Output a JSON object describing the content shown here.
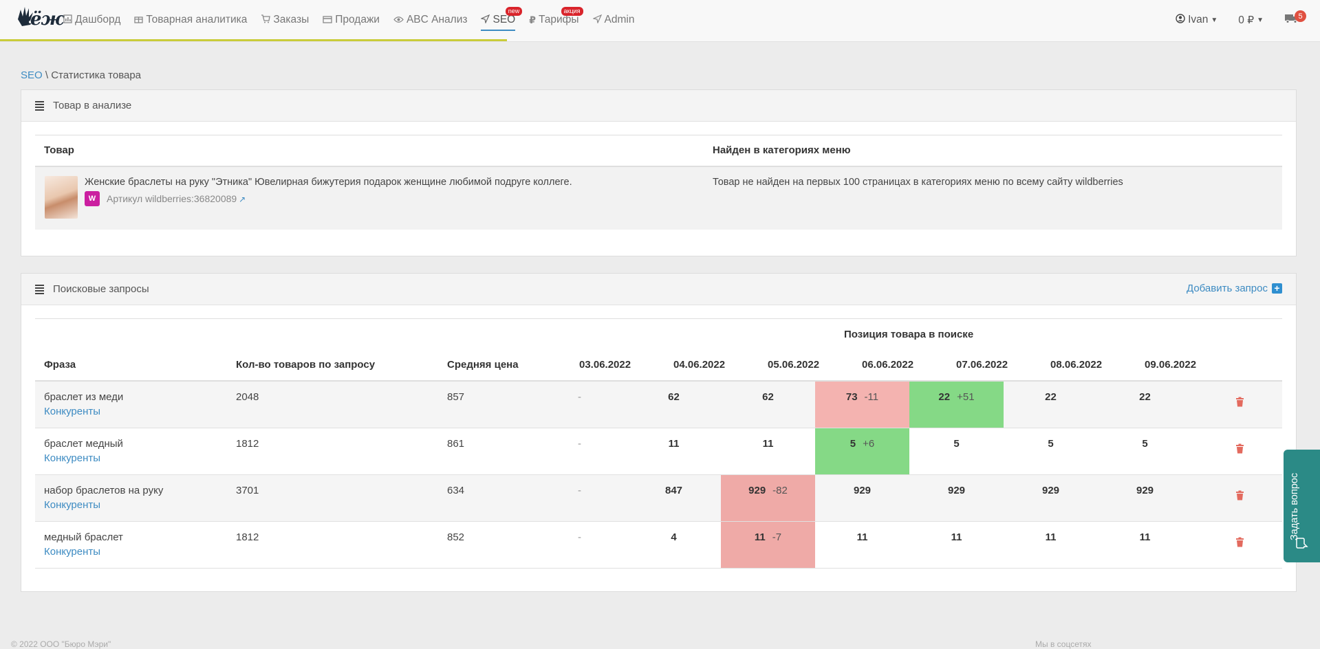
{
  "nav": {
    "logo": "ёж",
    "items": [
      {
        "label": "Дашборд",
        "icon": "bar-chart-icon"
      },
      {
        "label": "Товарная аналитика",
        "icon": "gift-icon"
      },
      {
        "label": "Заказы",
        "icon": "cart-icon"
      },
      {
        "label": "Продажи",
        "icon": "card-icon"
      },
      {
        "label": "ABC Анализ",
        "icon": "eye-icon"
      },
      {
        "label": "SEO",
        "icon": "send-icon",
        "badge": "new",
        "active": true
      },
      {
        "label": "Тарифы",
        "icon": "ruble-icon",
        "badge": "акция"
      },
      {
        "label": "Admin",
        "icon": "send-icon"
      }
    ],
    "user": "Ivan",
    "balance": "0 ₽",
    "cart_count": "5"
  },
  "breadcrumb": {
    "root": "SEO",
    "sep": " \\ ",
    "current": "Статистика товара"
  },
  "product_panel": {
    "title": "Товар в анализе",
    "col_product": "Товар",
    "col_found": "Найден в категориях меню",
    "product_name": "Женские браслеты на руку \"Этника\" Ювелирная бижутерия подарок женщине любимой подруге коллеге.",
    "wb_badge": "W",
    "article": "Артикул wildberries:36820089",
    "not_found": "Товар не найден на первых 100 страницах в категориях меню по всему сайту wildberries"
  },
  "queries_panel": {
    "title": "Поисковые запросы",
    "add_label": "Добавить запрос",
    "group_header": "Позиция товара в поиске",
    "headers": {
      "phrase": "Фраза",
      "count": "Кол-во товаров по запросу",
      "price": "Средняя цена"
    },
    "dates": [
      "03.06.2022",
      "04.06.2022",
      "05.06.2022",
      "06.06.2022",
      "07.06.2022",
      "08.06.2022",
      "09.06.2022"
    ],
    "competitors_label": "Конкуренты",
    "rows": [
      {
        "phrase": "браслет из меди",
        "count": "2048",
        "price": "857",
        "positions": [
          {
            "v": "-"
          },
          {
            "v": "62"
          },
          {
            "v": "62"
          },
          {
            "v": "73",
            "d": "-11",
            "hl": "red"
          },
          {
            "v": "22",
            "d": "+51",
            "hl": "green"
          },
          {
            "v": "22"
          },
          {
            "v": "22"
          }
        ]
      },
      {
        "phrase": "браслет медный",
        "count": "1812",
        "price": "861",
        "positions": [
          {
            "v": "-"
          },
          {
            "v": "11"
          },
          {
            "v": "11"
          },
          {
            "v": "5",
            "d": "+6",
            "hl": "green"
          },
          {
            "v": "5"
          },
          {
            "v": "5"
          },
          {
            "v": "5"
          }
        ]
      },
      {
        "phrase": "набор браслетов на руку",
        "count": "3701",
        "price": "634",
        "positions": [
          {
            "v": "-"
          },
          {
            "v": "847"
          },
          {
            "v": "929",
            "d": "-82",
            "hl": "red2"
          },
          {
            "v": "929"
          },
          {
            "v": "929"
          },
          {
            "v": "929"
          },
          {
            "v": "929"
          }
        ]
      },
      {
        "phrase": "медный браслет",
        "count": "1812",
        "price": "852",
        "positions": [
          {
            "v": "-"
          },
          {
            "v": "4"
          },
          {
            "v": "11",
            "d": "-7",
            "hl": "red2"
          },
          {
            "v": "11"
          },
          {
            "v": "11"
          },
          {
            "v": "11"
          },
          {
            "v": "11"
          }
        ]
      }
    ]
  },
  "help_tab": "Задать вопрос",
  "footer": {
    "left": "© 2022 ООО \"Бюро Мэри\"",
    "right": "Мы в соцсетях"
  },
  "colors": {
    "accent": "#3d8bc2",
    "red_cell": "#f4b3b0",
    "green_cell": "#85d986",
    "help_tab": "#2b8a86"
  }
}
